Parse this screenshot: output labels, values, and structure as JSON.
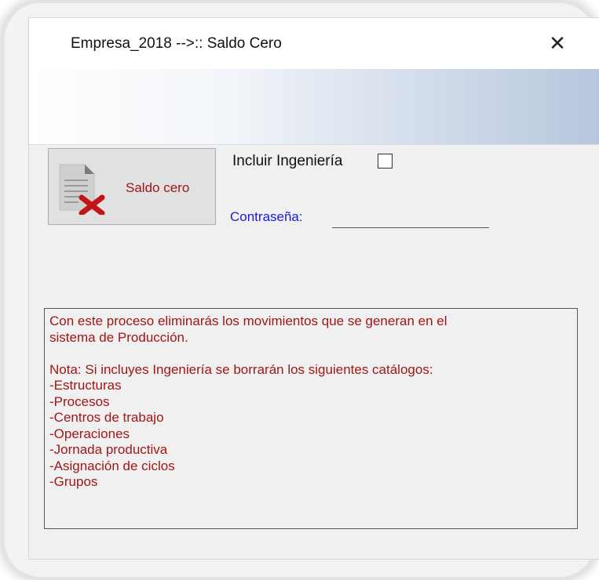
{
  "window": {
    "title": "Empresa_2018 -->:: Saldo Cero",
    "close_symbol": "✕"
  },
  "saldo_button": {
    "label": "Saldo cero",
    "icon": "document-delete-icon"
  },
  "options": {
    "include_engineering_label": "Incluir Ingeniería",
    "include_engineering_checked": false,
    "password_label": "Contraseña:",
    "password_value": ""
  },
  "notes": {
    "line1": "Con este proceso eliminarás los movimientos que se generan en el",
    "line2": "sistema de Producción.",
    "line3": "",
    "line4": "Nota: Si incluyes Ingeniería  se borrarán los siguientes catálogos:",
    "line5": "-Estructuras",
    "line6": "-Procesos",
    "line7": "-Centros de trabajo",
    "line8": "-Operaciones",
    "line9": "-Jornada productiva",
    "line10": "-Asignación de ciclos",
    "line11": "-Grupos"
  },
  "colors": {
    "accent_red": "#a01717",
    "label_blue": "#1a1ae0"
  }
}
